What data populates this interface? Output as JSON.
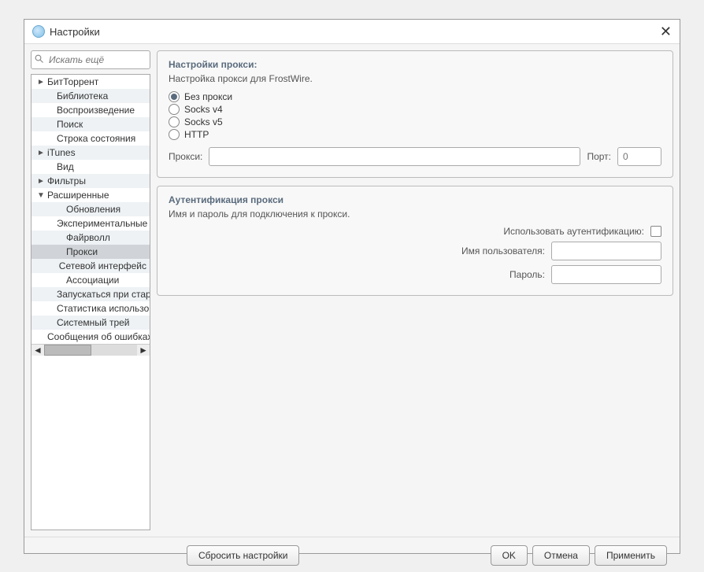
{
  "window": {
    "title": "Настройки"
  },
  "search": {
    "placeholder": "Искать ещё"
  },
  "tree": {
    "items": [
      {
        "label": "БитТоррент",
        "indent": 0,
        "expand": "►"
      },
      {
        "label": "Библиотека",
        "indent": 1,
        "expand": ""
      },
      {
        "label": "Воспроизведение",
        "indent": 1,
        "expand": ""
      },
      {
        "label": "Поиск",
        "indent": 1,
        "expand": ""
      },
      {
        "label": "Строка состояния",
        "indent": 1,
        "expand": ""
      },
      {
        "label": "iTunes",
        "indent": 0,
        "expand": "►"
      },
      {
        "label": "Вид",
        "indent": 1,
        "expand": ""
      },
      {
        "label": "Фильтры",
        "indent": 0,
        "expand": "►"
      },
      {
        "label": "Расширенные",
        "indent": 0,
        "expand": "▼"
      },
      {
        "label": "Обновления",
        "indent": 2,
        "expand": ""
      },
      {
        "label": "Экспериментальные",
        "indent": 2,
        "expand": ""
      },
      {
        "label": "Файрволл",
        "indent": 2,
        "expand": ""
      },
      {
        "label": "Прокси",
        "indent": 2,
        "expand": "",
        "selected": true
      },
      {
        "label": "Сетевой интерфейс",
        "indent": 2,
        "expand": ""
      },
      {
        "label": "Ассоциации",
        "indent": 2,
        "expand": ""
      },
      {
        "label": "Запускаться при старте",
        "indent": 2,
        "expand": ""
      },
      {
        "label": "Статистика использования",
        "indent": 2,
        "expand": ""
      },
      {
        "label": "Системный трей",
        "indent": 1,
        "expand": ""
      },
      {
        "label": "Сообщения об ошибках",
        "indent": 1,
        "expand": ""
      }
    ]
  },
  "proxy_settings": {
    "title": "Настройки прокси:",
    "description": "Настройка прокси для FrostWire.",
    "options": {
      "none": "Без прокси",
      "socks4": "Socks v4",
      "socks5": "Socks v5",
      "http": "HTTP"
    },
    "proxy_label": "Прокси:",
    "port_label": "Порт:",
    "port_placeholder": "0"
  },
  "proxy_auth": {
    "title": "Аутентификация прокси",
    "description": "Имя и пароль для подключения к прокси.",
    "use_auth_label": "Использовать аутентификацию:",
    "username_label": "Имя пользователя:",
    "password_label": "Пароль:"
  },
  "buttons": {
    "reset": "Сбросить настройки",
    "ok": "OK",
    "cancel": "Отмена",
    "apply": "Применить"
  }
}
